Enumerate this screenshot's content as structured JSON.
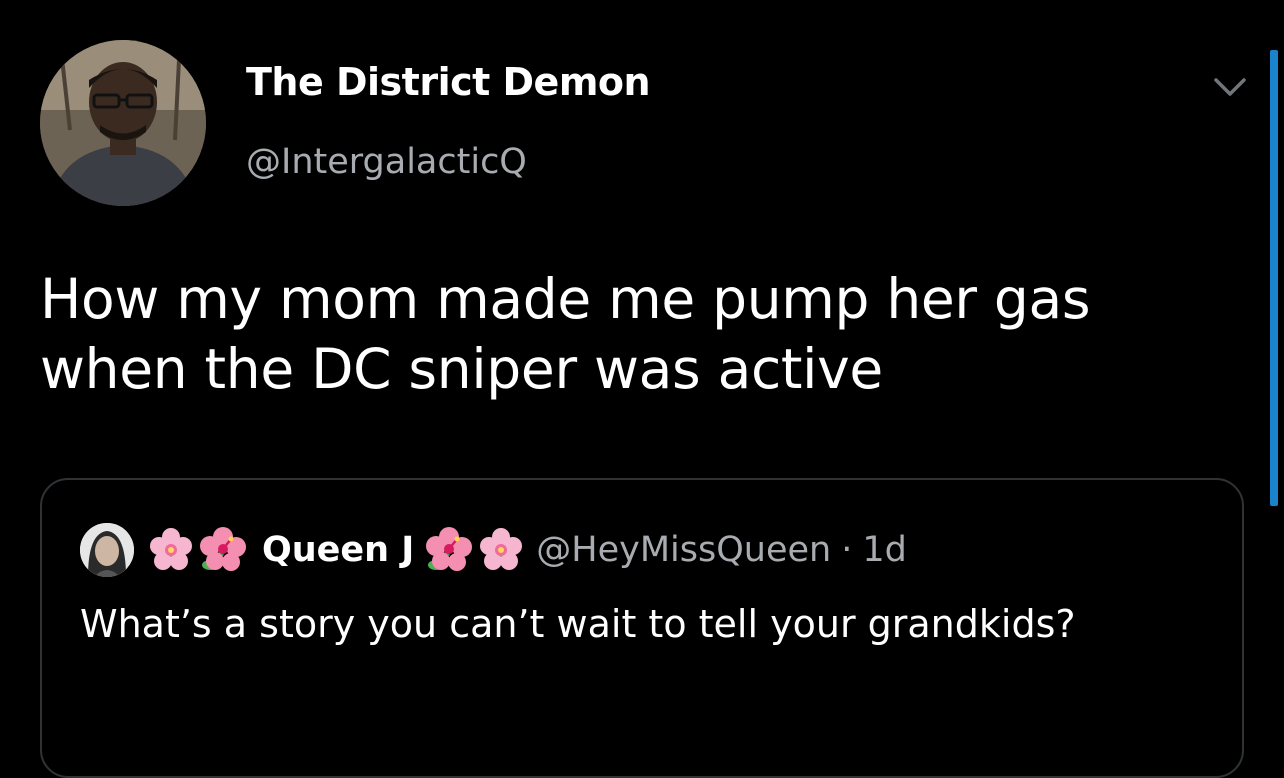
{
  "tweet": {
    "author": {
      "display_name": "The District Demon",
      "handle": "@IntergalacticQ"
    },
    "text": "How my mom made me pump her gas when the DC sniper was active",
    "menu_icon": "chevron-down-icon"
  },
  "quoted_tweet": {
    "author": {
      "display_name": "Queen J",
      "handle": "@HeyMissQueen"
    },
    "separator": "·",
    "time": "1d",
    "text": "What’s a story you can’t wait to tell your grandkids?",
    "decorations": [
      "cherry-blossom-icon",
      "hibiscus-icon",
      "hibiscus-icon",
      "cherry-blossom-icon"
    ]
  },
  "colors": {
    "background": "#000000",
    "primary_text": "#ffffff",
    "secondary_text": "#a8acb0",
    "border": "#2f3336",
    "accent": "#1d9bf0"
  }
}
